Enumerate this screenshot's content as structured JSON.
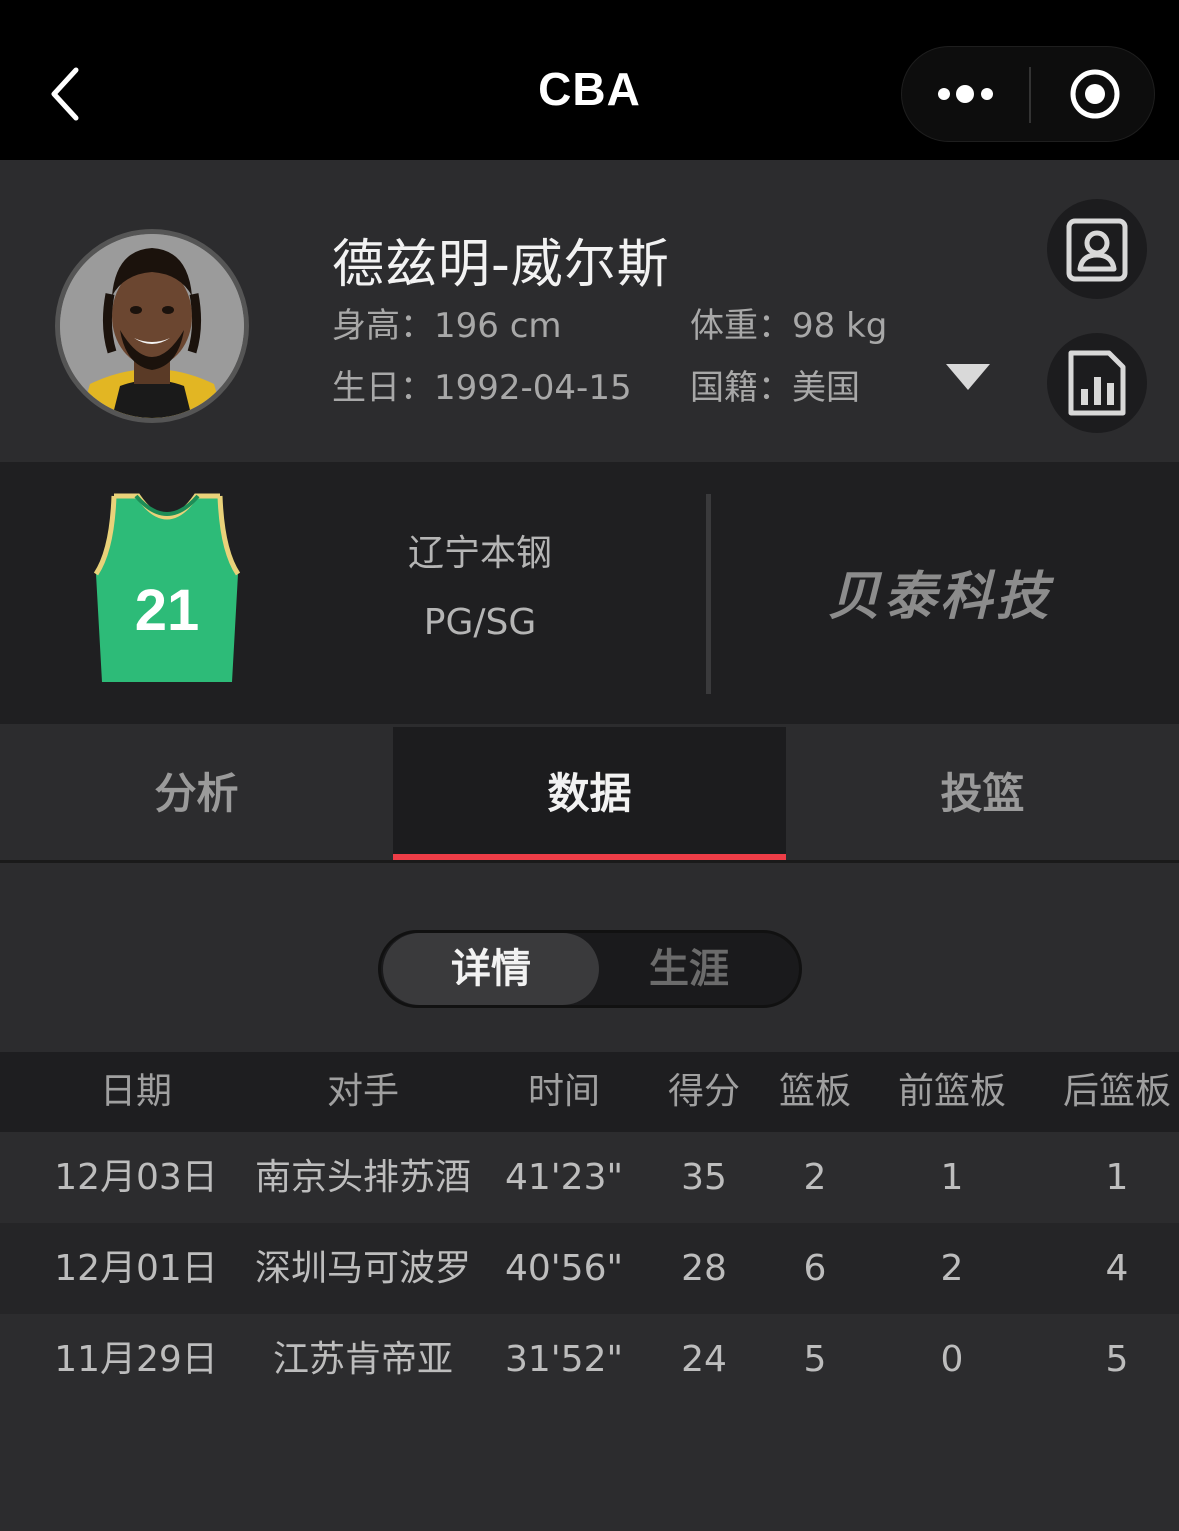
{
  "nav": {
    "title": "CBA"
  },
  "player": {
    "name": "德兹明-威尔斯",
    "height_label": "身高：",
    "height_value": "196 cm",
    "weight_label": "体重：",
    "weight_value": "98 kg",
    "birthday_label": "生日：",
    "birthday_value": "1992-04-15",
    "nationality_label": "国籍：",
    "nationality_value": "美国"
  },
  "team": {
    "jersey_number": "21",
    "jersey_color": "#2dbb78",
    "name": "辽宁本钢",
    "position": "PG/SG",
    "sponsor": "贝泰科技"
  },
  "tabs": [
    {
      "label": "分析",
      "active": false
    },
    {
      "label": "数据",
      "active": true
    },
    {
      "label": "投篮",
      "active": false
    }
  ],
  "segment": {
    "selected": "详情",
    "other": "生涯"
  },
  "table": {
    "headers": [
      "日期",
      "对手",
      "时间",
      "得分",
      "篮板",
      "前篮板",
      "后篮板"
    ],
    "rows": [
      [
        "12月03日",
        "南京头排苏酒",
        "41'23\"",
        "35",
        "2",
        "1",
        "1"
      ],
      [
        "12月01日",
        "深圳马可波罗",
        "40'56\"",
        "28",
        "6",
        "2",
        "4"
      ],
      [
        "11月29日",
        "江苏肯帝亚",
        "31'52\"",
        "24",
        "5",
        "0",
        "5"
      ]
    ]
  },
  "icons": {
    "back": "chevron-left-icon",
    "more": "more-dots-icon",
    "target": "target-icon",
    "profile_card": "profile-card-icon",
    "stats_report": "stats-report-icon",
    "expand": "triangle-down-icon"
  },
  "colors": {
    "accent": "#ee3d47"
  }
}
